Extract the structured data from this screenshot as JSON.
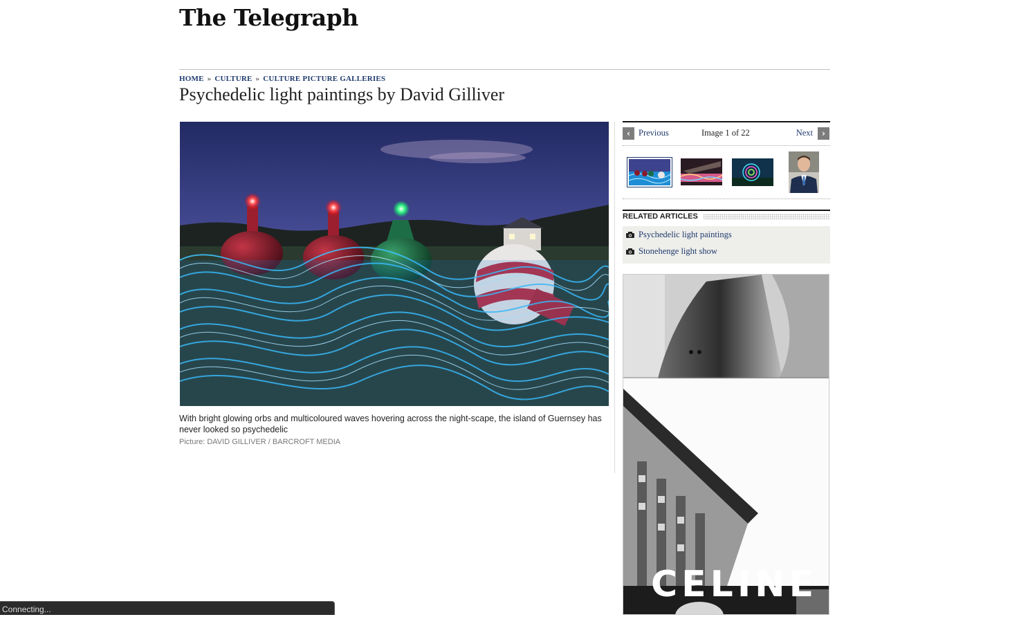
{
  "site": {
    "logo_text": "The Telegraph"
  },
  "breadcrumb": {
    "home": "HOME",
    "culture": "CULTURE",
    "galleries": "CULTURE PICTURE GALLERIES",
    "separator": "»"
  },
  "page": {
    "title": "Psychedelic light paintings by David Gilliver"
  },
  "photo": {
    "caption": "With bright glowing orbs and multicoloured waves hovering across the night-scape, the island of Guernsey has never looked so psychedelic",
    "credit": "Picture: DAVID GILLIVER / BARCROFT MEDIA"
  },
  "gallery_nav": {
    "previous": "Previous",
    "next": "Next",
    "counter": "Image 1 of 22",
    "current_index": 1,
    "total": 22,
    "prev_icon": "chevron-left-icon",
    "next_icon": "chevron-right-icon"
  },
  "related": {
    "heading": "RELATED ARTICLES",
    "items": [
      {
        "label": "Psychedelic light paintings",
        "icon": "camera-icon"
      },
      {
        "label": "Stonehenge light show",
        "icon": "camera-icon"
      }
    ]
  },
  "ad": {
    "brand": "CELINE"
  },
  "status_bar": {
    "text": "Connecting..."
  },
  "colors": {
    "link": "#1f3a6e",
    "rule": "#bdbdbd",
    "panel": "#eeeeea",
    "status_bg": "#2b2b2b"
  }
}
